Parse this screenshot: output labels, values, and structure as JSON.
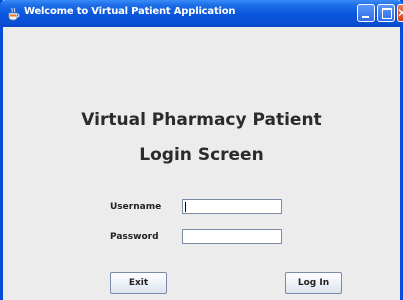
{
  "window": {
    "title": "Welcome to Virtual Patient Application",
    "icon": "java-coffee-cup-icon",
    "controls": [
      "minimize-icon",
      "maximize-icon",
      "close-icon"
    ]
  },
  "main": {
    "heading_line1": "Virtual Pharmacy Patient",
    "heading_line2": "Login Screen"
  },
  "form": {
    "username_label": "Username",
    "username_value": "",
    "password_label": "Password",
    "password_value": ""
  },
  "buttons": {
    "exit_label": "Exit",
    "login_label": "Log In"
  },
  "colors": {
    "titlebar": "#0b56de",
    "window_background": "#ececec",
    "close_button": "#d04018"
  }
}
